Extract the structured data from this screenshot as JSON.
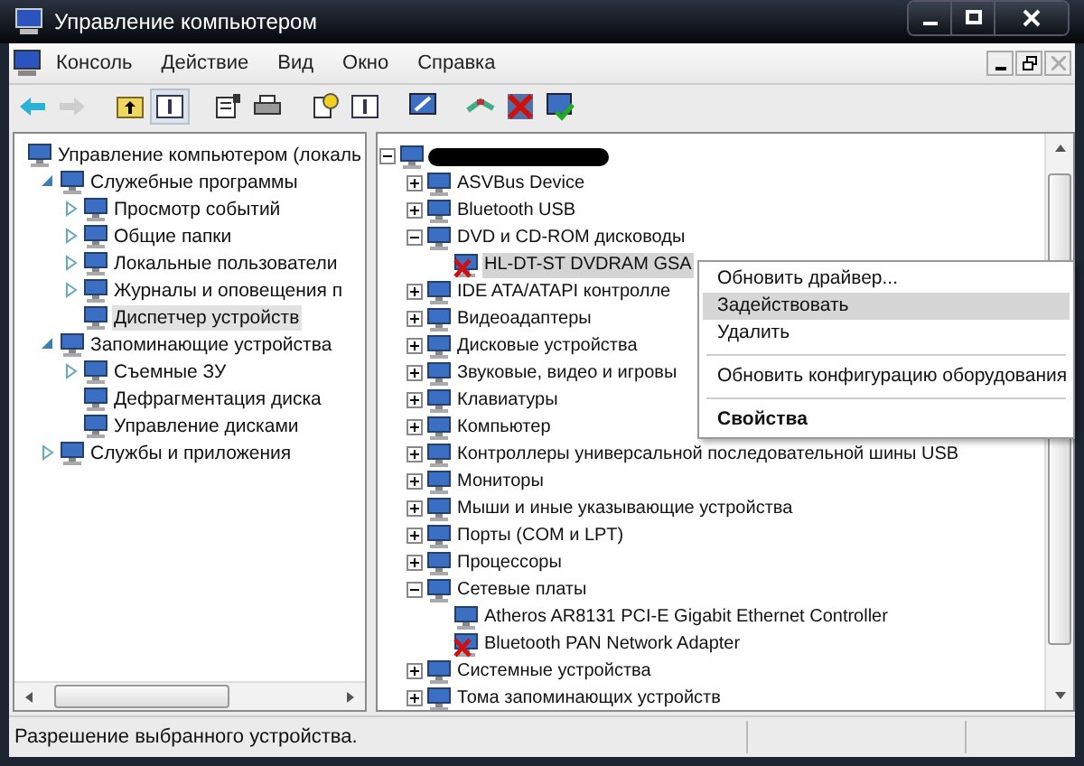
{
  "window": {
    "title": "Управление компьютером"
  },
  "menu": [
    "Консоль",
    "Действие",
    "Вид",
    "Окно",
    "Справка"
  ],
  "toolbar": [
    {
      "disabled": false,
      "pressed": false
    },
    {
      "disabled": true,
      "pressed": false
    },
    {
      "disabled": false,
      "pressed": false
    },
    {
      "disabled": false,
      "pressed": true
    },
    {
      "disabled": false,
      "pressed": false
    },
    {
      "disabled": false,
      "pressed": false
    },
    {
      "disabled": false,
      "pressed": false
    },
    {
      "disabled": false,
      "pressed": false
    },
    {
      "disabled": false,
      "pressed": false
    },
    {
      "disabled": false,
      "pressed": false
    },
    {
      "disabled": false,
      "pressed": false
    },
    {
      "disabled": false,
      "pressed": false
    }
  ],
  "left_tree": [
    {
      "label": "Управление компьютером (локаль",
      "selected": false,
      "children": [
        {
          "label": "Служебные программы",
          "expanded": true,
          "selected": false,
          "children": [
            {
              "label": "Просмотр событий",
              "expanded": false,
              "selected": false
            },
            {
              "label": "Общие папки",
              "expanded": false,
              "selected": false
            },
            {
              "label": "Локальные пользователи",
              "expanded": false,
              "selected": false
            },
            {
              "label": "Журналы и оповещения п",
              "expanded": false,
              "selected": false
            },
            {
              "label": "Диспетчер устройств",
              "selected": true
            }
          ]
        },
        {
          "label": "Запоминающие устройства",
          "expanded": true,
          "selected": false,
          "children": [
            {
              "label": "Съемные ЗУ",
              "expanded": false,
              "selected": false
            },
            {
              "label": "Дефрагментация диска",
              "selected": false
            },
            {
              "label": "Управление дисками",
              "selected": false
            }
          ]
        },
        {
          "label": "Службы и приложения",
          "expanded": false,
          "selected": false
        }
      ]
    }
  ],
  "device_tree": [
    {
      "redacted": true,
      "expanded": true,
      "children": [
        {
          "label": "ASVBus Device",
          "expanded": false,
          "selected": false
        },
        {
          "label": "Bluetooth USB",
          "expanded": false,
          "selected": false
        },
        {
          "label": "DVD и CD-ROM дисководы",
          "expanded": true,
          "selected": false,
          "children": [
            {
              "label": "HL-DT-ST DVDRAM GSA",
              "selected": true,
              "disabled": true
            }
          ]
        },
        {
          "label": "IDE ATA/ATAPI контролле",
          "expanded": false,
          "selected": false
        },
        {
          "label": "Видеоадаптеры",
          "expanded": false,
          "selected": false
        },
        {
          "label": "Дисковые устройства",
          "expanded": false,
          "selected": false
        },
        {
          "label": "Звуковые, видео и игровы",
          "expanded": false,
          "selected": false
        },
        {
          "label": "Клавиатуры",
          "expanded": false,
          "selected": false
        },
        {
          "label": "Компьютер",
          "expanded": false,
          "selected": false
        },
        {
          "label": "Контроллеры универсальной последовательной шины USB",
          "expanded": false,
          "selected": false
        },
        {
          "label": "Мониторы",
          "expanded": false,
          "selected": false
        },
        {
          "label": "Мыши и иные указывающие устройства",
          "expanded": false,
          "selected": false
        },
        {
          "label": "Порты (COM и LPT)",
          "expanded": false,
          "selected": false
        },
        {
          "label": "Процессоры",
          "expanded": false,
          "selected": false
        },
        {
          "label": "Сетевые платы",
          "expanded": true,
          "selected": false,
          "children": [
            {
              "label": "Atheros AR8131 PCI-E Gigabit Ethernet Controller",
              "selected": false,
              "disabled": false
            },
            {
              "label": "Bluetooth PAN Network Adapter",
              "selected": false,
              "disabled": true
            }
          ]
        },
        {
          "label": "Системные устройства",
          "expanded": false,
          "selected": false
        },
        {
          "label": "Тома запоминающих устройств",
          "expanded": false,
          "selected": false
        }
      ]
    }
  ],
  "context_menu": [
    {
      "kind": "item",
      "label": "Обновить драйвер...",
      "selected": false,
      "default": false
    },
    {
      "kind": "item",
      "label": "Задействовать",
      "selected": true,
      "default": false
    },
    {
      "kind": "item",
      "label": "Удалить",
      "selected": false,
      "default": false
    },
    {
      "kind": "separator"
    },
    {
      "kind": "item",
      "label": "Обновить конфигурацию оборудования",
      "selected": false,
      "default": false
    },
    {
      "kind": "separator"
    },
    {
      "kind": "item",
      "label": "Свойства",
      "selected": false,
      "default": true
    }
  ],
  "status_bar": {
    "text": "Разрешение выбранного устройства."
  }
}
